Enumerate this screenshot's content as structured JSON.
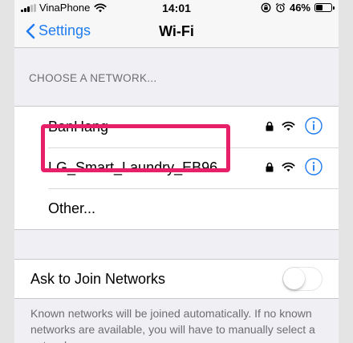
{
  "status_bar": {
    "carrier": "VinaPhone",
    "time": "14:01",
    "battery_percent": "46%",
    "battery_level": 0.46
  },
  "nav": {
    "back_label": "Settings",
    "title": "Wi-Fi"
  },
  "section_header": "CHOOSE A NETWORK...",
  "networks": [
    {
      "name": "BanHang",
      "secured": true
    },
    {
      "name": "LG_Smart_Laundry_EB96",
      "secured": true,
      "highlighted": true
    },
    {
      "name": "Other..."
    }
  ],
  "ask_to_join": {
    "label": "Ask to Join Networks",
    "enabled": false
  },
  "footer_note": "Known networks will be joined automatically. If no known networks are available, you will have to manually select a network.",
  "colors": {
    "accent": "#1f7cf0",
    "highlight": "#e8206a",
    "background": "#efeff4"
  }
}
